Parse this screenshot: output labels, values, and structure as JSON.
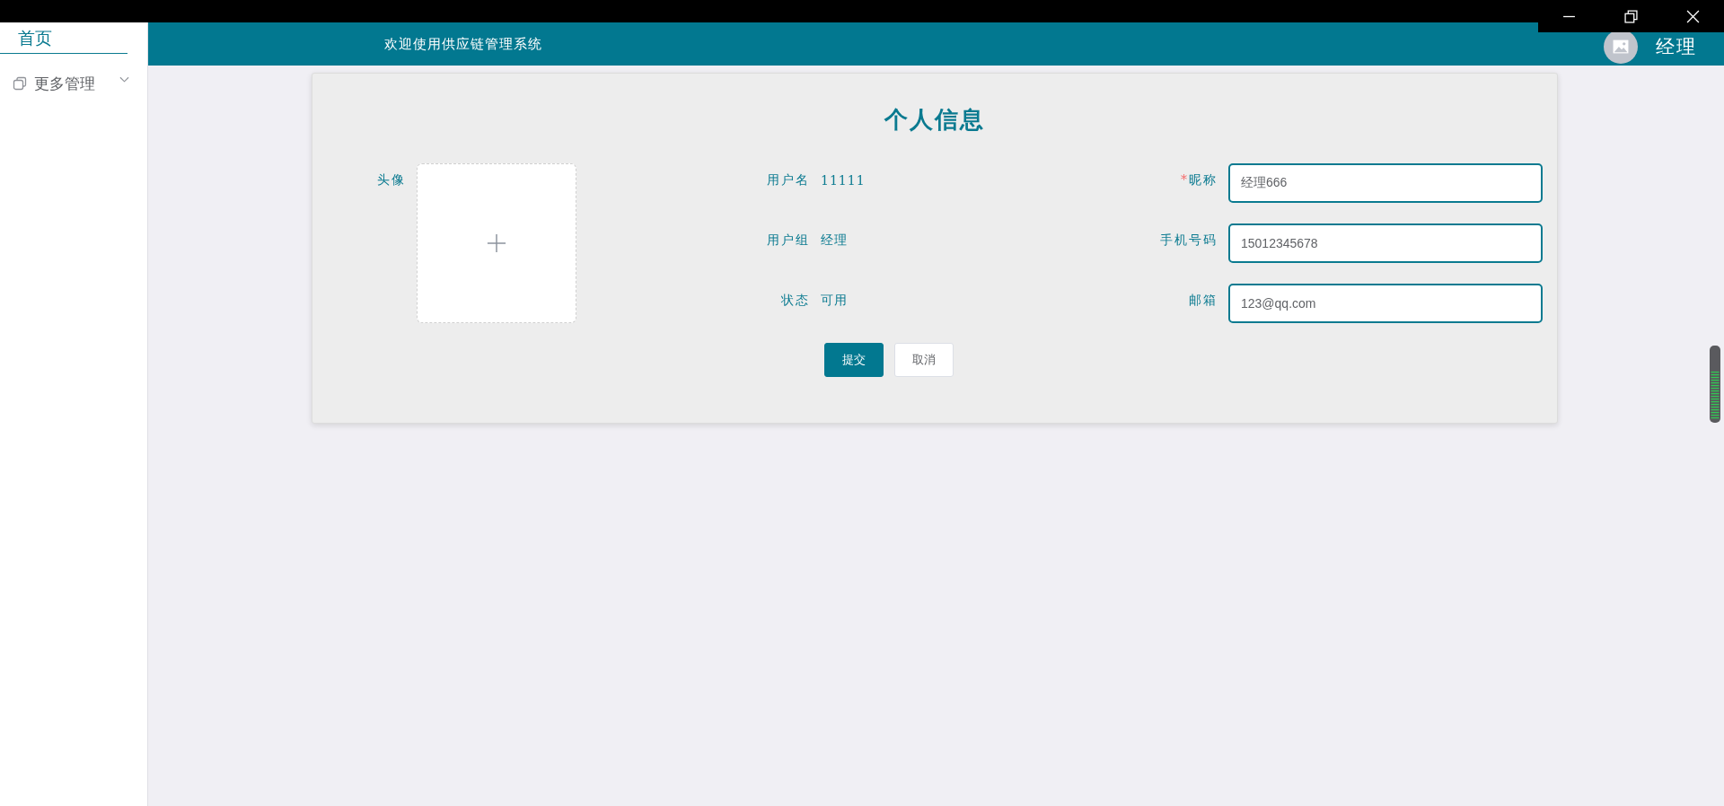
{
  "sidebar": {
    "tabs": [
      {
        "label": "首页",
        "selected": true
      }
    ],
    "items": [
      {
        "label": "更多管理",
        "expanded": false
      }
    ]
  },
  "header": {
    "title": "欢迎使用供应链管理系统",
    "user": "经理"
  },
  "profile": {
    "title": "个人信息",
    "avatar": {
      "label": "头像"
    },
    "info": [
      {
        "label": "用户名",
        "value": "11111"
      },
      {
        "label": "用户组",
        "value": "经理"
      },
      {
        "label": "状态",
        "value": "可用"
      }
    ],
    "fields": [
      {
        "label": "昵称",
        "mark": "*",
        "value": "经理666"
      },
      {
        "label": "手机号码",
        "value": "15012345678"
      },
      {
        "label": "邮箱",
        "value": "123@qq.com"
      }
    ],
    "buttons": [
      {
        "label": "提交",
        "kind": "primary"
      },
      {
        "label": "取消",
        "kind": "default"
      }
    ]
  }
}
